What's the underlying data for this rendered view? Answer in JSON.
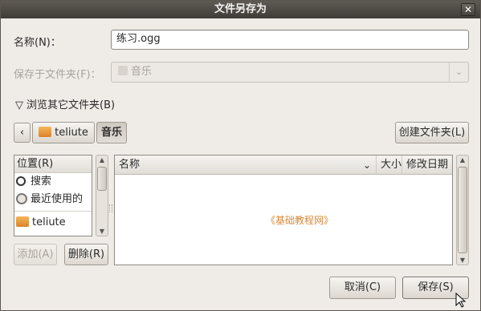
{
  "window": {
    "title": "文件另存为",
    "close_glyph": "✕"
  },
  "name_row": {
    "label": "名称(N)：",
    "value": "练习.ogg"
  },
  "save_in_row": {
    "label": "保存于文件夹(F)：",
    "selected": "音乐",
    "arrow": "⌄"
  },
  "expander": {
    "label": "浏览其它文件夹(B)",
    "arrow": "▽"
  },
  "path_bar": {
    "back": "‹",
    "crumbs": [
      "teliute",
      "音乐"
    ]
  },
  "create_folder_label": "创建文件夹(L)",
  "places": {
    "header": "位置(R)",
    "items": [
      {
        "label": "搜索",
        "icon": "search-icon"
      },
      {
        "label": "最近使用的",
        "icon": "recent-icon"
      },
      {
        "label": "teliute",
        "icon": "folder-home-icon"
      }
    ],
    "add_label": "添加(A)",
    "remove_label": "删除(R)"
  },
  "files": {
    "columns": [
      "名称",
      "大小",
      "修改日期"
    ],
    "sort_glyph": "⌄",
    "watermark": "《基础教程网》"
  },
  "buttons": {
    "cancel": "取消(C)",
    "save": "保存(S)"
  }
}
